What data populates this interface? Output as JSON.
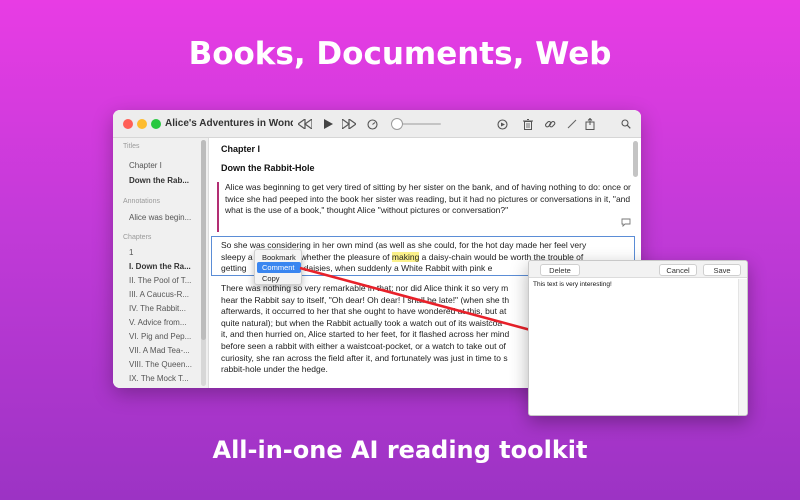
{
  "headline_top": "Books, Documents, Web",
  "headline_bottom": "All-in-one AI reading toolkit",
  "window": {
    "title": "Alice's Adventures in Wonderl...",
    "playback_progress_percent": 5
  },
  "sidebar": {
    "titles_header": "Titles",
    "titles": [
      "Chapter I",
      "Down the Rab..."
    ],
    "annotations_header": "Annotations",
    "annotations": [
      "Alice was begin..."
    ],
    "chapters_header": "Chapters",
    "chapters": [
      "1",
      "I. Down the Ra...",
      "II. The Pool of T...",
      "III. A Caucus-R...",
      "IV. The Rabbit...",
      "V. Advice from...",
      "VI. Pig and Pep...",
      "VII. A Mad Tea-...",
      "VIII. The Queen...",
      "IX. The Mock T..."
    ]
  },
  "content": {
    "chapter_label": "Chapter I",
    "chapter_title": "Down the Rabbit-Hole",
    "p1": "Alice was beginning to get very tired of sitting by her sister on the bank, and of having nothing to do: once or twice she had peeped into the book her sister was reading, but it had no pictures or conversations in it, \"and what is the use of a book,\" thought Alice \"without pictures or conversation?\"",
    "p2_line1": "So she was considering in her own mind (as well as she could, for the hot day made her feel very",
    "p2_line2_a": "sleepy a",
    "p2_line2_b": "whether the pleasure of",
    "p2_highlight": "making",
    "p2_line2_c": "a daisy-chain would be worth the trouble of",
    "p2_line3_a": "getting",
    "p2_line3_b": "g the daisies, when suddenly a White Rabbit with pink e",
    "p3_lines": [
      "There was nothing so very remarkable in that; nor did Alice think it so very m",
      "hear the Rabbit say to itself, \"Oh dear! Oh dear! I shall be late!\" (when she th",
      "afterwards, it occurred to her that she ought to have wondered at this, but at",
      "quite natural); but when the Rabbit actually took a watch out of its waistcoa",
      "it, and then hurried on, Alice started to her feet, for it flashed across her mind",
      "before seen a rabbit with either a waistcoat-pocket, or a watch to take out of",
      "curiosity, she ran across the field after it, and fortunately was just in time to s",
      "rabbit-hole under the hedge."
    ]
  },
  "context_menu": {
    "items": [
      "Bookmark",
      "Comment",
      "Copy"
    ],
    "active_index": 1
  },
  "comment_panel": {
    "delete_label": "Delete",
    "cancel_label": "Cancel",
    "save_label": "Save",
    "text": "This text is very interesting!"
  },
  "colors": {
    "annotation_bar": "#b22e73",
    "highlight": "#fbf18a",
    "arrow": "#e8212a",
    "menu_active": "#3a86f0"
  }
}
